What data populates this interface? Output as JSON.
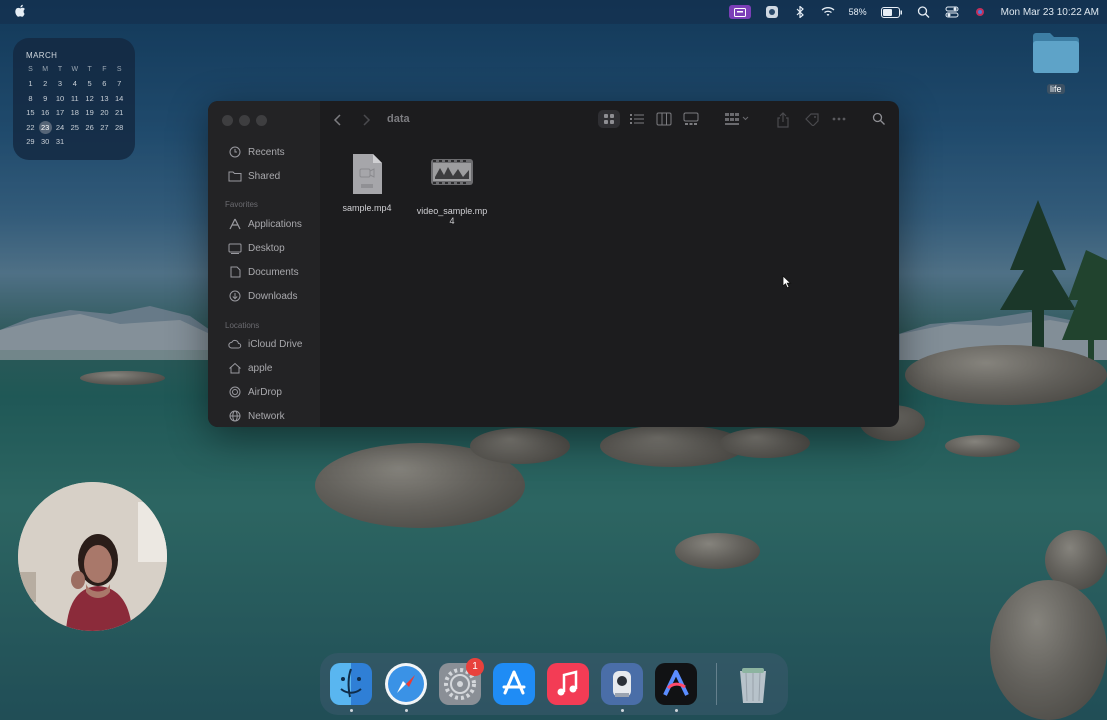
{
  "menubar": {
    "battery_percent": "58%",
    "datetime": "Mon Mar 23  10:22 AM"
  },
  "calendar": {
    "month": "MARCH",
    "weekdays": [
      "S",
      "M",
      "T",
      "W",
      "T",
      "F",
      "S"
    ],
    "weeks": [
      [
        "1",
        "2",
        "3",
        "4",
        "5",
        "6",
        "7"
      ],
      [
        "8",
        "9",
        "10",
        "11",
        "12",
        "13",
        "14"
      ],
      [
        "15",
        "16",
        "17",
        "18",
        "19",
        "20",
        "21"
      ],
      [
        "22",
        "23",
        "24",
        "25",
        "26",
        "27",
        "28"
      ],
      [
        "29",
        "30",
        "31",
        "",
        "",
        "",
        ""
      ]
    ],
    "today": "23"
  },
  "desktop_folder": {
    "label": "life"
  },
  "finder": {
    "title": "data",
    "sidebar": {
      "items_top": [
        {
          "label": "Recents",
          "icon": "clock-icon"
        },
        {
          "label": "Shared",
          "icon": "shared-folder-icon"
        }
      ],
      "favorites_title": "Favorites",
      "favorites": [
        {
          "label": "Applications",
          "icon": "applications-icon"
        },
        {
          "label": "Desktop",
          "icon": "desktop-icon"
        },
        {
          "label": "Documents",
          "icon": "document-icon"
        },
        {
          "label": "Downloads",
          "icon": "download-icon"
        }
      ],
      "locations_title": "Locations",
      "locations": [
        {
          "label": "iCloud Drive",
          "icon": "cloud-icon"
        },
        {
          "label": "apple",
          "icon": "home-icon"
        },
        {
          "label": "AirDrop",
          "icon": "airdrop-icon"
        },
        {
          "label": "Network",
          "icon": "network-icon"
        }
      ]
    },
    "files": [
      {
        "name": "sample.mp4",
        "icon": "video-file-icon"
      },
      {
        "name_line1": "video_sample.mp",
        "name_line2": "4",
        "icon": "video-thumbnail-icon"
      }
    ]
  },
  "dock": {
    "apps": [
      "Finder",
      "Safari",
      "System Settings",
      "App Store",
      "Music",
      "Screen Recorder",
      "Arc",
      "Trash"
    ],
    "settings_badge": "1"
  }
}
